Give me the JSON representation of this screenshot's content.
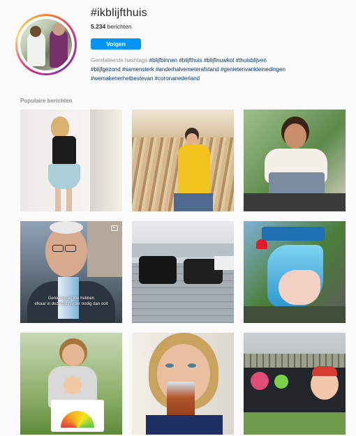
{
  "header": {
    "hashtag": "#ikblijfthuis",
    "post_count": "5.234",
    "post_count_label": "berichten",
    "follow_label": "Volgen",
    "related_label": "Gerelateerde hashtags",
    "related_tags": [
      "#blijfbinnen",
      "#blijfthuis",
      "#blijfinuwkot",
      "#thuisblijven",
      "#blijfgezond",
      "#samensterk",
      "#anderhalvemeterafstand",
      "#genietenvankleinedingen",
      "#wemakenerhetbestevan",
      "#coronanederland"
    ]
  },
  "popular": {
    "title": "Populaire berichten",
    "video_caption_line1": "Geniet op je, We hebben",
    "video_caption_line2": "elkaar in deze tijd harder nodig dan ooit"
  },
  "colors": {
    "accent": "#0095f6",
    "link": "#00376b",
    "muted": "#8e8e8e"
  }
}
